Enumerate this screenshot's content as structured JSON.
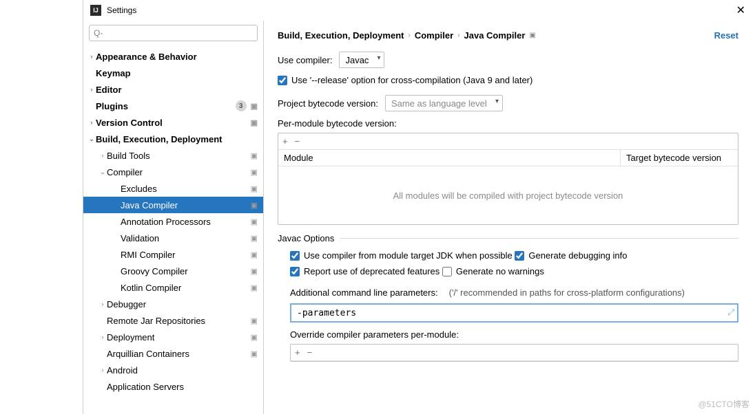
{
  "window": {
    "title": "Settings"
  },
  "search": {
    "placeholder": "Q-"
  },
  "tree": [
    {
      "label": "Appearance & Behavior",
      "level": 0,
      "chev": "›"
    },
    {
      "label": "Keymap",
      "level": 0
    },
    {
      "label": "Editor",
      "level": 0,
      "chev": "›"
    },
    {
      "label": "Plugins",
      "level": 0,
      "badge": "3",
      "proj": true
    },
    {
      "label": "Version Control",
      "level": 0,
      "chev": "›",
      "proj": true
    },
    {
      "label": "Build, Execution, Deployment",
      "level": 0,
      "chev": "⌄"
    },
    {
      "label": "Build Tools",
      "level": 1,
      "chev": "›",
      "proj": true
    },
    {
      "label": "Compiler",
      "level": 1,
      "chev": "⌄",
      "proj": true
    },
    {
      "label": "Excludes",
      "level": 2,
      "proj": true
    },
    {
      "label": "Java Compiler",
      "level": 2,
      "selected": true,
      "proj": true
    },
    {
      "label": "Annotation Processors",
      "level": 2,
      "proj": true
    },
    {
      "label": "Validation",
      "level": 2,
      "proj": true
    },
    {
      "label": "RMI Compiler",
      "level": 2,
      "proj": true
    },
    {
      "label": "Groovy Compiler",
      "level": 2,
      "proj": true
    },
    {
      "label": "Kotlin Compiler",
      "level": 2,
      "proj": true
    },
    {
      "label": "Debugger",
      "level": 1,
      "chev": "›"
    },
    {
      "label": "Remote Jar Repositories",
      "level": 1,
      "proj": true
    },
    {
      "label": "Deployment",
      "level": 1,
      "chev": "›",
      "proj": true
    },
    {
      "label": "Arquillian Containers",
      "level": 1,
      "proj": true
    },
    {
      "label": "Android",
      "level": 1,
      "chev": "›"
    },
    {
      "label": "Application Servers",
      "level": 1
    }
  ],
  "breadcrumb": {
    "a": "Build, Execution, Deployment",
    "b": "Compiler",
    "c": "Java Compiler",
    "reset": "Reset"
  },
  "main": {
    "use_compiler_label": "Use compiler:",
    "use_compiler_value": "Javac",
    "release_option": "Use '--release' option for cross-compilation (Java 9 and later)",
    "project_bc_label": "Project bytecode version:",
    "project_bc_value": "Same as language level",
    "per_module_label": "Per-module bytecode version:",
    "grid": {
      "col1": "Module",
      "col2": "Target bytecode version",
      "empty": "All modules will be compiled with project bytecode version"
    },
    "javac_section": "Javac Options",
    "opt1": "Use compiler from module target JDK when possible",
    "opt2": "Generate debugging info",
    "opt3": "Report use of deprecated features",
    "opt4": "Generate no warnings",
    "params_label": "Additional command line parameters:",
    "params_hint": "('/' recommended in paths for cross-platform configurations)",
    "params_value": "-parameters",
    "override_label": "Override compiler parameters per-module:"
  },
  "watermark": "@51CTO博客"
}
